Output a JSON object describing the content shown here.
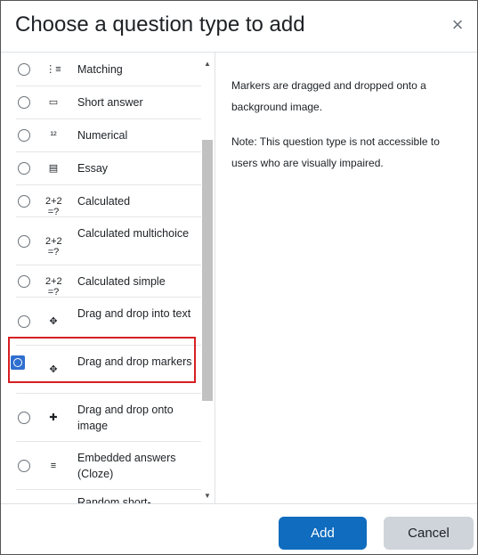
{
  "dialog": {
    "title": "Choose a question type to add",
    "close_glyph": "×"
  },
  "options": [
    {
      "label": "Matching",
      "icon": "matching-icon",
      "glyph": "⋮≡"
    },
    {
      "label": "Short answer",
      "icon": "short-answer-icon",
      "glyph": "▭"
    },
    {
      "label": "Numerical",
      "icon": "numerical-icon",
      "glyph": "¹²"
    },
    {
      "label": "Essay",
      "icon": "essay-icon",
      "glyph": "▤"
    },
    {
      "label": "Calculated",
      "icon": "calculated-icon",
      "glyph": "2+2 =?"
    },
    {
      "label": "Calculated multichoice",
      "icon": "calculated-multichoice-icon",
      "glyph": "2+2 =?"
    },
    {
      "label": "Calculated simple",
      "icon": "calculated-simple-icon",
      "glyph": "2+2 =?"
    },
    {
      "label": "Drag and drop into text",
      "icon": "drag-drop-text-icon",
      "glyph": "✥"
    },
    {
      "label": "Drag and drop markers",
      "icon": "drag-drop-markers-icon",
      "glyph": "✥",
      "selected": true
    },
    {
      "label": "Drag and drop onto image",
      "icon": "drag-drop-image-icon",
      "glyph": "✚"
    },
    {
      "label": "Embedded answers (Cloze)",
      "icon": "cloze-icon",
      "glyph": "≡"
    },
    {
      "label": "Random short-",
      "icon": "random-short-answer-icon",
      "glyph": ":?:"
    }
  ],
  "description": {
    "p1": "Markers are dragged and dropped onto a background image.",
    "p2": "Note: This question type is not accessible to users who are visually impaired."
  },
  "footer": {
    "add_label": "Add",
    "cancel_label": "Cancel"
  },
  "colors": {
    "primary": "#0f6cbf",
    "secondary": "#ced4da",
    "highlight_border": "#d71f23"
  }
}
